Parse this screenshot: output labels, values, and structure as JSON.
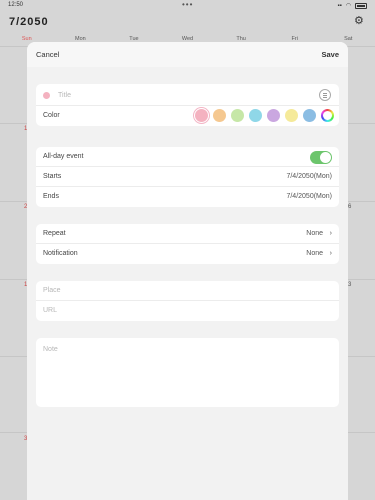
{
  "status_bar": {
    "time": "12:50",
    "dots": "•••"
  },
  "calendar": {
    "title": "7/2050",
    "weekdays": [
      "Sun",
      "Mon",
      "Tue",
      "Wed",
      "Thu",
      "Fri",
      "Sat"
    ],
    "visible_day_numbers": {
      "left": [
        "1",
        "2",
        "1",
        "3"
      ],
      "right": [
        "6",
        "3"
      ]
    }
  },
  "sheet": {
    "cancel_label": "Cancel",
    "save_label": "Save",
    "title_placeholder": "Title",
    "color_label": "Color",
    "colors": [
      "#f4b2c0",
      "#f5c890",
      "#c6e7a7",
      "#8fd7e8",
      "#caa7e0",
      "#f5ea9a",
      "#8bbde3"
    ],
    "selected_color": "#f4b2c0",
    "all_day_label": "All-day event",
    "all_day": true,
    "starts_label": "Starts",
    "starts_value": "7/4/2050(Mon)",
    "ends_label": "Ends",
    "ends_value": "7/4/2050(Mon)",
    "repeat_label": "Repeat",
    "repeat_value": "None",
    "notification_label": "Notification",
    "notification_value": "None",
    "place_placeholder": "Place",
    "url_placeholder": "URL",
    "note_placeholder": "Note"
  }
}
